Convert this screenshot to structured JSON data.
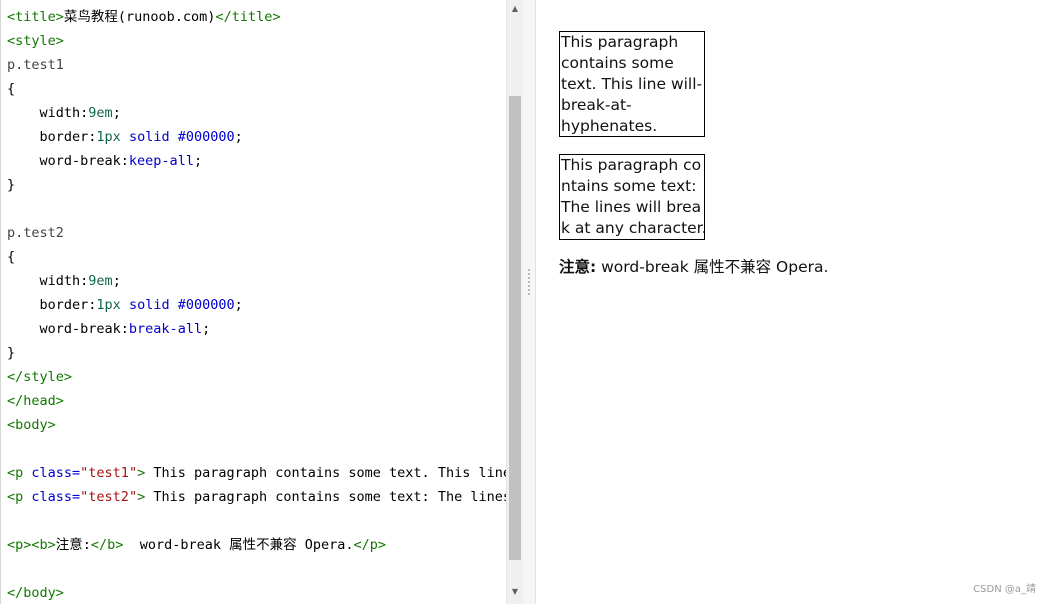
{
  "editor": {
    "lines": [
      [
        {
          "c": "t",
          "v": "<title>"
        },
        {
          "c": "",
          "v": "菜鸟教程(runoob.com)"
        },
        {
          "c": "t",
          "v": "</title>"
        }
      ],
      [
        {
          "c": "t",
          "v": "<style>"
        }
      ],
      [
        {
          "c": "sl",
          "v": "p.test1"
        }
      ],
      [
        {
          "c": "",
          "v": "{"
        }
      ],
      [
        {
          "c": "",
          "v": "    "
        },
        {
          "c": "pr",
          "v": "width:"
        },
        {
          "c": "nm",
          "v": "9em"
        },
        {
          "c": "",
          "v": ";"
        }
      ],
      [
        {
          "c": "",
          "v": "    "
        },
        {
          "c": "pr",
          "v": "border:"
        },
        {
          "c": "nm",
          "v": "1px"
        },
        {
          "c": "",
          "v": " "
        },
        {
          "c": "ky",
          "v": "solid"
        },
        {
          "c": "",
          "v": " "
        },
        {
          "c": "ky",
          "v": "#000000"
        },
        {
          "c": "",
          "v": ";"
        }
      ],
      [
        {
          "c": "",
          "v": "    "
        },
        {
          "c": "pr",
          "v": "word-break:"
        },
        {
          "c": "ky",
          "v": "keep-all"
        },
        {
          "c": "",
          "v": ";"
        }
      ],
      [
        {
          "c": "",
          "v": "}"
        }
      ],
      [
        {
          "c": "",
          "v": ""
        }
      ],
      [
        {
          "c": "sl",
          "v": "p.test2"
        }
      ],
      [
        {
          "c": "",
          "v": "{"
        }
      ],
      [
        {
          "c": "",
          "v": "    "
        },
        {
          "c": "pr",
          "v": "width:"
        },
        {
          "c": "nm",
          "v": "9em"
        },
        {
          "c": "",
          "v": ";"
        }
      ],
      [
        {
          "c": "",
          "v": "    "
        },
        {
          "c": "pr",
          "v": "border:"
        },
        {
          "c": "nm",
          "v": "1px"
        },
        {
          "c": "",
          "v": " "
        },
        {
          "c": "ky",
          "v": "solid"
        },
        {
          "c": "",
          "v": " "
        },
        {
          "c": "ky",
          "v": "#000000"
        },
        {
          "c": "",
          "v": ";"
        }
      ],
      [
        {
          "c": "",
          "v": "    "
        },
        {
          "c": "pr",
          "v": "word-break:"
        },
        {
          "c": "ky",
          "v": "break-all"
        },
        {
          "c": "",
          "v": ";"
        }
      ],
      [
        {
          "c": "",
          "v": "}"
        }
      ],
      [
        {
          "c": "t",
          "v": "</style>"
        }
      ],
      [
        {
          "c": "t",
          "v": "</head>"
        }
      ],
      [
        {
          "c": "t",
          "v": "<body>"
        }
      ],
      [
        {
          "c": "",
          "v": ""
        }
      ],
      [
        {
          "c": "t",
          "v": "<p "
        },
        {
          "c": "at",
          "v": "class="
        },
        {
          "c": "st",
          "v": "\"test1\""
        },
        {
          "c": "t",
          "v": ">"
        },
        {
          "c": "",
          "v": " This paragraph contains some text. This line"
        }
      ],
      [
        {
          "c": "t",
          "v": "<p "
        },
        {
          "c": "at",
          "v": "class="
        },
        {
          "c": "st",
          "v": "\"test2\""
        },
        {
          "c": "t",
          "v": ">"
        },
        {
          "c": "",
          "v": " This paragraph contains some text: The lines"
        }
      ],
      [
        {
          "c": "",
          "v": ""
        }
      ],
      [
        {
          "c": "t",
          "v": "<p><b>"
        },
        {
          "c": "",
          "v": "注意:"
        },
        {
          "c": "t",
          "v": "</b>"
        },
        {
          "c": "",
          "v": "  word-break 属性不兼容 Opera."
        },
        {
          "c": "t",
          "v": "</p>"
        }
      ],
      [
        {
          "c": "",
          "v": ""
        }
      ],
      [
        {
          "c": "t",
          "v": "</body>"
        }
      ]
    ],
    "colors": {
      "tag": "#117700",
      "attribute": "#0000cc",
      "string": "#aa1111",
      "keyword": "#0000cc",
      "number": "#116644"
    }
  },
  "scrollbar": {
    "up_icon": "triangle-up",
    "down_icon": "triangle-down",
    "up_glyph": "▲",
    "down_glyph": "▼"
  },
  "preview": {
    "test1_text": "This paragraph\ncontains some\ntext. This line will-\nbreak-at-\nhyphenates.",
    "test2_text": "This paragraph co\nntains some text:\nThe lines will brea\nk at any character.",
    "note_bold": "注意:",
    "note_text": " word-break 属性不兼容 Opera.",
    "watermark": "CSDN @a_靖"
  }
}
